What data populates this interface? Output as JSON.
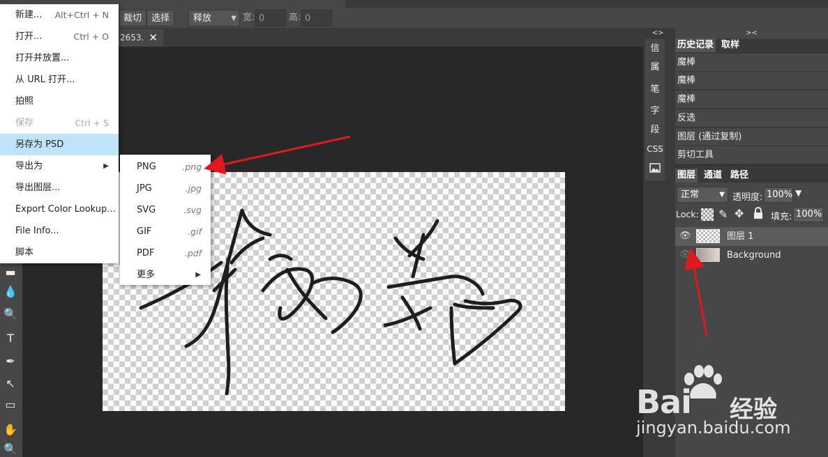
{
  "toolbar_options": {
    "crop_label": "裁切",
    "select_label": "选择",
    "mode_value": "释放",
    "width_label": "宽:",
    "width_value": "0",
    "height_label": "高:",
    "height_value": "0"
  },
  "document_tab": {
    "name": "2653.",
    "close": "✕"
  },
  "file_menu": {
    "items": [
      {
        "label": "新建...",
        "shortcut": "Alt+Ctrl + N"
      },
      {
        "label": "打开...",
        "shortcut": "Ctrl + O"
      },
      {
        "label": "打开并放置...",
        "shortcut": ""
      },
      {
        "label": "从 URL 打开...",
        "shortcut": ""
      },
      {
        "label": "拍照",
        "shortcut": ""
      },
      {
        "label": "保存",
        "shortcut": "Ctrl + S"
      },
      {
        "label": "另存为 PSD",
        "shortcut": ""
      },
      {
        "label": "导出为",
        "shortcut": "▶"
      },
      {
        "label": "导出图层...",
        "shortcut": ""
      },
      {
        "label": "Export Color Lookup...",
        "shortcut": ""
      },
      {
        "label": "File Info...",
        "shortcut": ""
      },
      {
        "label": "脚本",
        "shortcut": ""
      }
    ]
  },
  "export_submenu": {
    "items": [
      {
        "label": "PNG",
        "ext": ".png"
      },
      {
        "label": "JPG",
        "ext": ".jpg"
      },
      {
        "label": "SVG",
        "ext": ".svg"
      },
      {
        "label": "GIF",
        "ext": ".gif"
      },
      {
        "label": "PDF",
        "ext": ".pdf"
      },
      {
        "label": "更多",
        "ext": "▶"
      }
    ]
  },
  "mini_panel": {
    "collapse": "<>",
    "items": [
      "信",
      "属",
      "笔",
      "字",
      "段",
      "CSS"
    ]
  },
  "right_panel": {
    "collapse": "><",
    "history_tab": "历史记录",
    "sample_tab": "取样",
    "history": [
      "魔棒",
      "魔棒",
      "魔棒",
      "反选",
      "图层 (通过复制)",
      "剪切工具"
    ],
    "layers_tab": "图层",
    "channels_tab": "通道",
    "paths_tab": "路径",
    "blend_mode": "正常",
    "opacity_label": "透明度:",
    "opacity_value": "100%",
    "lock_label": "Lock:",
    "fill_label": "填充:",
    "fill_value": "100%",
    "layers": [
      {
        "name": "图层 1"
      },
      {
        "name": "Background"
      }
    ]
  },
  "watermark": {
    "brand": "Bai",
    "brand_suffix": "经验",
    "url": "jingyan.baidu.com"
  },
  "colors": {
    "accent_red": "#e0191e",
    "menu_highlight": "#bfe3f7",
    "panel_bg": "#474747"
  }
}
